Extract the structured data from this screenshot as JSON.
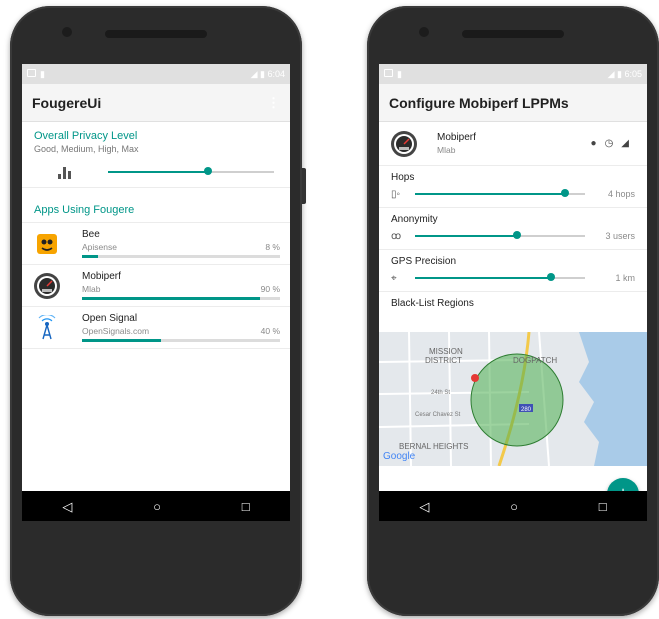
{
  "left_phone": {
    "status": {
      "time": "6:04"
    },
    "app_title": "FougereUi",
    "privacy": {
      "title": "Overall Privacy Level",
      "subtitle": "Good, Medium, High, Max",
      "level": 0.6
    },
    "apps_header": "Apps Using Fougere",
    "apps": [
      {
        "name": "Bee",
        "source": "Apisense",
        "percent": "8 %",
        "progress": 0.08,
        "icon": "bee-icon"
      },
      {
        "name": "Mobiperf",
        "source": "Mlab",
        "percent": "90 %",
        "progress": 0.9,
        "icon": "speedometer-icon"
      },
      {
        "name": "Open Signal",
        "source": "OpenSignals.com",
        "percent": "40 %",
        "progress": 0.4,
        "icon": "signal-tower-icon"
      }
    ]
  },
  "right_phone": {
    "status": {
      "time": "6:05"
    },
    "app_title": "Configure Mobiperf LPPMs",
    "app": {
      "name": "Mobiperf",
      "source": "Mlab"
    },
    "lppms": [
      {
        "label": "Hops",
        "value": "4 hops",
        "level": 0.88,
        "icon": "phone-icon"
      },
      {
        "label": "Anonymity",
        "value": "3 users",
        "level": 0.6,
        "icon": "group-icon"
      },
      {
        "label": "GPS Precision",
        "value": "1 km",
        "level": 0.8,
        "icon": "gps-icon"
      }
    ],
    "blacklist_title": "Black-List Regions",
    "map": {
      "labels": [
        "MISSION",
        "DISTRICT",
        "DOGPATCH",
        "BERNAL HEIGHTS",
        "24th St",
        "280",
        "Google",
        "Cesar Chavez St"
      ]
    },
    "fab_label": "+"
  },
  "colors": {
    "accent": "#009688"
  }
}
